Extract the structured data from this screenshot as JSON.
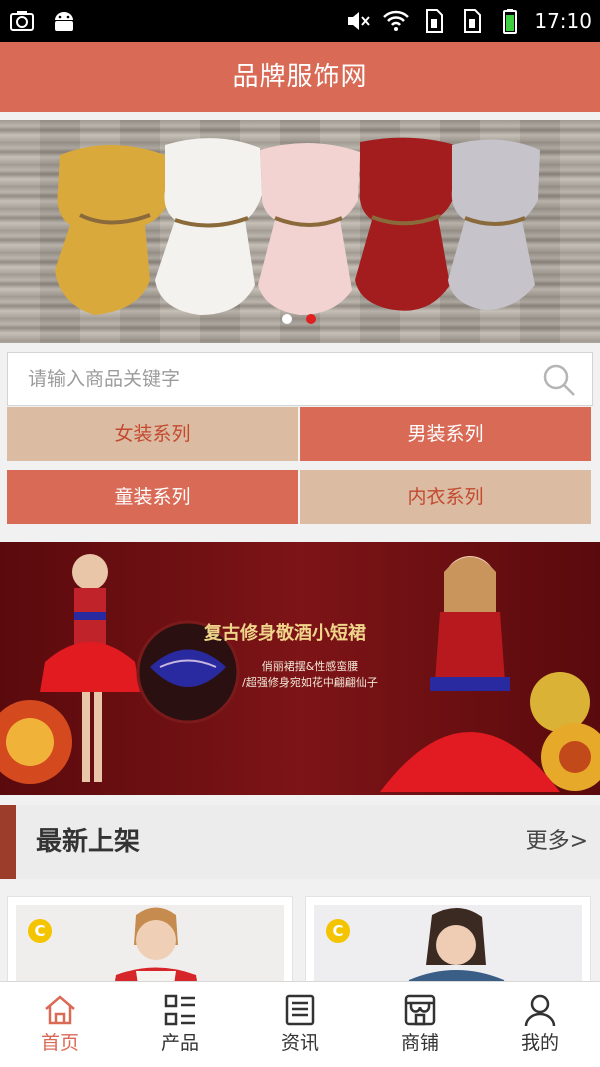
{
  "status_bar": {
    "time": "17:10",
    "left_icons": [
      "camera-icon",
      "android-icon"
    ],
    "right_icons": [
      "mute-icon",
      "wifi-icon",
      "sim1-icon",
      "sim2-icon",
      "battery-icon"
    ]
  },
  "header": {
    "title": "品牌服饰网"
  },
  "banner": {
    "slides": 2,
    "active_slide": 2
  },
  "search": {
    "placeholder": "请输入商品关键字",
    "value": ""
  },
  "categories": [
    {
      "label": "女装系列",
      "style": "light"
    },
    {
      "label": "男装系列",
      "style": "dark"
    },
    {
      "label": "童装系列",
      "style": "dark"
    },
    {
      "label": "内衣系列",
      "style": "light"
    }
  ],
  "promo": {
    "headline": "复古修身敬酒小短裙",
    "line1": "俏丽裙摆&性感蛮腰",
    "line2": "/超强修身宛如花中翩翩仙子"
  },
  "section": {
    "title": "最新上架",
    "more": "更多>"
  },
  "products": [
    {
      "badge": "C"
    },
    {
      "badge": "C"
    }
  ],
  "nav": [
    {
      "label": "首页",
      "icon": "home-icon",
      "active": true
    },
    {
      "label": "产品",
      "icon": "grid-list-icon",
      "active": false
    },
    {
      "label": "资讯",
      "icon": "news-icon",
      "active": false
    },
    {
      "label": "商铺",
      "icon": "shop-icon",
      "active": false
    },
    {
      "label": "我的",
      "icon": "user-icon",
      "active": false
    }
  ],
  "colors": {
    "accent": "#d96a55",
    "accent_light": "#dcbba3",
    "accent_text": "#c24a2f",
    "section_bar": "#9b3d2a",
    "badge": "#f5c400"
  }
}
